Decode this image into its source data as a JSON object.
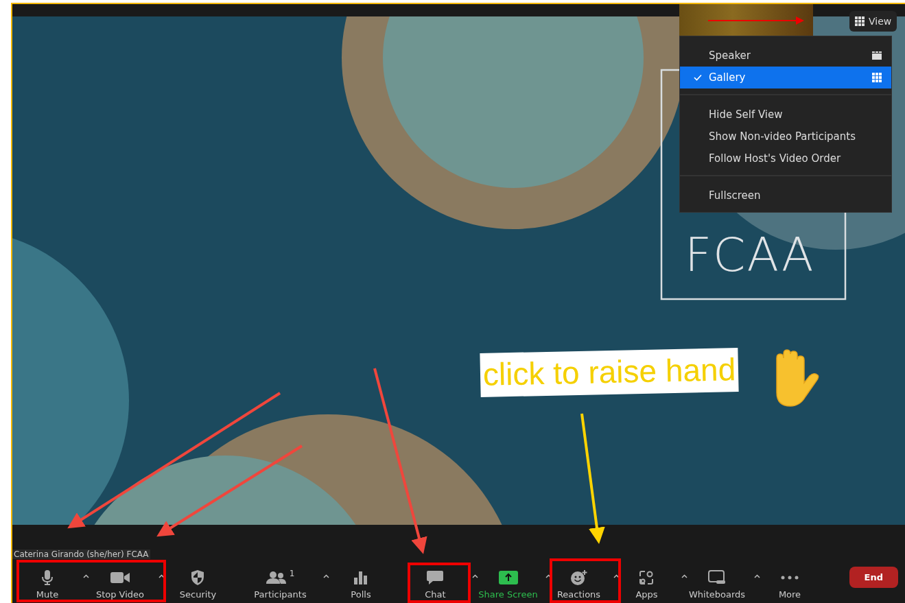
{
  "view_button": {
    "label": "View"
  },
  "view_menu": {
    "sections": [
      [
        {
          "kind": "speaker",
          "label": "Speaker",
          "selected": false
        },
        {
          "kind": "gallery",
          "label": "Gallery",
          "selected": true
        }
      ],
      [
        {
          "kind": "plain",
          "label": "Hide Self View",
          "selected": false
        },
        {
          "kind": "plain",
          "label": "Show Non-video Participants",
          "selected": false
        },
        {
          "kind": "plain",
          "label": "Follow Host's Video Order",
          "selected": false
        }
      ],
      [
        {
          "kind": "plain",
          "label": "Fullscreen",
          "selected": false
        }
      ]
    ]
  },
  "shared_screen": {
    "logo": "FCAA"
  },
  "annotation": {
    "text": "click to raise hand"
  },
  "name_label": "Caterina Girando (she/her) FCAA",
  "toolbar": [
    {
      "kind": "mic",
      "label": "Mute",
      "caret": true
    },
    {
      "kind": "video",
      "label": "Stop Video",
      "caret": true
    },
    {
      "kind": "shield",
      "label": "Security",
      "caret": false
    },
    {
      "kind": "people",
      "label": "Participants",
      "count": "1",
      "caret": true
    },
    {
      "kind": "polls",
      "label": "Polls",
      "caret": false
    },
    {
      "kind": "chat",
      "label": "Chat",
      "caret": true
    },
    {
      "kind": "share",
      "label": "Share Screen",
      "caret": true
    },
    {
      "kind": "reactions",
      "label": "Reactions",
      "caret": true
    },
    {
      "kind": "apps",
      "label": "Apps",
      "caret": true
    },
    {
      "kind": "whiteboard",
      "label": "Whiteboards",
      "caret": true
    },
    {
      "kind": "more",
      "label": "More",
      "caret": false
    }
  ],
  "end_button": {
    "label": "End"
  }
}
